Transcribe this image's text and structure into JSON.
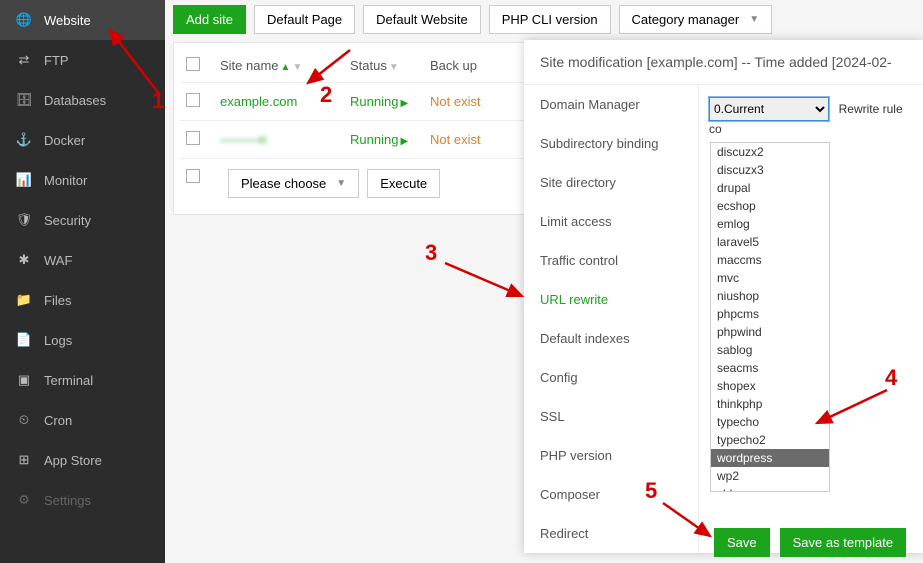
{
  "sidebar": {
    "items": [
      {
        "label": "Website",
        "icon": "globe",
        "active": true
      },
      {
        "label": "FTP",
        "icon": "ftp"
      },
      {
        "label": "Databases",
        "icon": "db"
      },
      {
        "label": "Docker",
        "icon": "docker"
      },
      {
        "label": "Monitor",
        "icon": "monitor"
      },
      {
        "label": "Security",
        "icon": "shield"
      },
      {
        "label": "WAF",
        "icon": "waf"
      },
      {
        "label": "Files",
        "icon": "folder"
      },
      {
        "label": "Logs",
        "icon": "logs"
      },
      {
        "label": "Terminal",
        "icon": "terminal"
      },
      {
        "label": "Cron",
        "icon": "cron"
      },
      {
        "label": "App Store",
        "icon": "apps"
      },
      {
        "label": "Settings",
        "icon": "settings"
      }
    ]
  },
  "toolbar": {
    "add": "Add site",
    "default_page": "Default Page",
    "default_site": "Default Website",
    "php_cli": "PHP CLI version",
    "cat_mgr": "Category manager"
  },
  "table": {
    "headers": {
      "name": "Site name",
      "status": "Status",
      "backup": "Back up"
    },
    "rows": [
      {
        "name": "example.com",
        "status": "Running",
        "backup": "Not exist"
      },
      {
        "name": "———n",
        "status": "Running",
        "backup": "Not exist",
        "blur": true
      }
    ],
    "please_choose": "Please choose",
    "execute": "Execute"
  },
  "modal": {
    "title": "Site modification [example.com]  --  Time added [2024-02-",
    "tabs": [
      "Domain Manager",
      "Subdirectory binding",
      "Site directory",
      "Limit access",
      "Traffic control",
      "URL rewrite",
      "Default indexes",
      "Config",
      "SSL",
      "PHP version",
      "Composer",
      "Redirect"
    ],
    "active_tab": "URL rewrite",
    "select_value": "0.Current",
    "rewrite_label": "Rewrite rule co"
  },
  "dropdown": {
    "items": [
      "discuzx2",
      "discuzx3",
      "drupal",
      "ecshop",
      "emlog",
      "laravel5",
      "maccms",
      "mvc",
      "niushop",
      "phpcms",
      "phpwind",
      "sablog",
      "seacms",
      "shopex",
      "thinkphp",
      "typecho",
      "typecho2",
      "wordpress",
      "wp2",
      "zblog"
    ],
    "selected": "wordpress"
  },
  "buttons": {
    "save": "Save",
    "save_tpl": "Save as template"
  },
  "annotations": {
    "n1": "1",
    "n2": "2",
    "n3": "3",
    "n4": "4",
    "n5": "5"
  }
}
